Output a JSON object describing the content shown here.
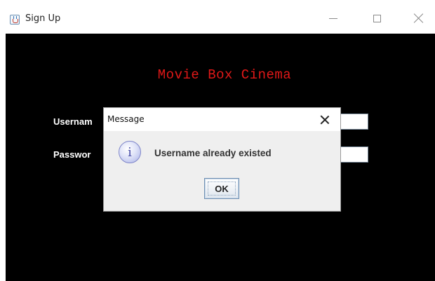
{
  "window": {
    "title": "Sign Up",
    "icon": "java-app-icon",
    "controls": [
      "minimize",
      "maximize",
      "close"
    ]
  },
  "app": {
    "heading": "Movie Box Cinema",
    "heading_color": "#e01818",
    "background": "#000000",
    "fields": {
      "username_label": "Usernam",
      "password_label": "Passwor"
    }
  },
  "dialog": {
    "title": "Message",
    "icon": "info-icon",
    "message": "Username already existed",
    "ok_label": "OK"
  }
}
